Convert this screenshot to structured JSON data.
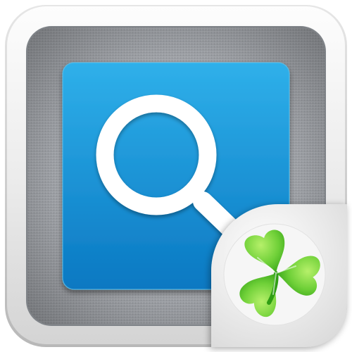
{
  "icon": {
    "frame_icon": "rounded-square-frame",
    "inner_panel_icon": "linen-textured-panel",
    "tile_icon": "blue-square-tile",
    "glyph_icon": "magnifying-glass-icon",
    "badge_icon": "clover-badge-icon",
    "colors": {
      "frame_light": "#fbfbfb",
      "frame_dark": "#cfcfcf",
      "panel_light": "#a9abb0",
      "panel_dark": "#7f8287",
      "tile_top": "#2ea9e6",
      "tile_bottom": "#0b7dc7",
      "glyph": "#ffffff",
      "clover_light": "#8fe34a",
      "clover_dark": "#2e9e12",
      "badge_bg": "#f4f4f4"
    }
  }
}
